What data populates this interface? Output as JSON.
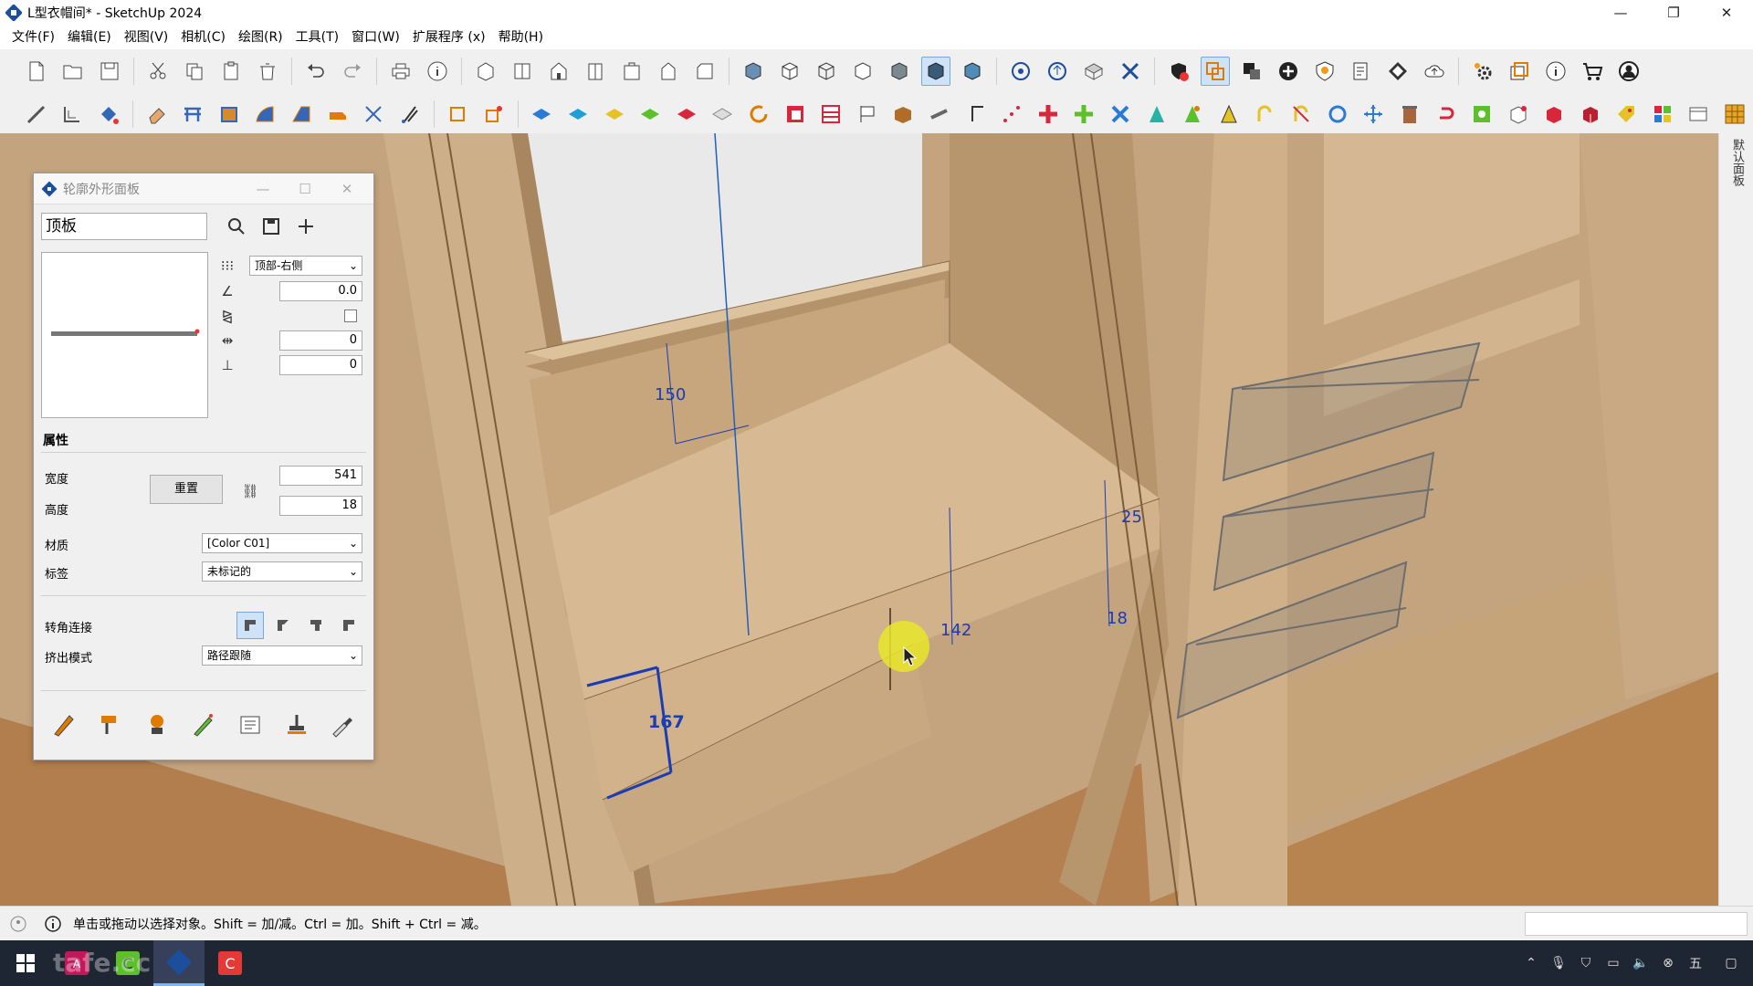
{
  "window": {
    "title": "L型衣帽间* - SketchUp 2024",
    "minimize": "—",
    "maximize": "❐",
    "close": "✕"
  },
  "menu": [
    "文件(F)",
    "编辑(E)",
    "视图(V)",
    "相机(C)",
    "绘图(R)",
    "工具(T)",
    "窗口(W)",
    "扩展程序 (x)",
    "帮助(H)"
  ],
  "side_tab": {
    "label": "默认面板"
  },
  "panel": {
    "title": "轮廓外形面板",
    "name_value": "顶板",
    "alignment_select": "顶部-右侧",
    "angle_value": "0.0",
    "offset_x_value": "0",
    "offset_y_value": "0",
    "properties_title": "属性",
    "width_label": "宽度",
    "width_value": "541",
    "height_label": "高度",
    "height_value": "18",
    "reset_label": "重置",
    "material_label": "材质",
    "material_value": "[Color C01]",
    "tag_label": "标签",
    "tag_value": "未标记的",
    "corner_label": "转角连接",
    "extrude_label": "挤出模式",
    "extrude_value": "路径跟随"
  },
  "dimensions": [
    "150",
    "25",
    "142",
    "18",
    "167"
  ],
  "status": {
    "text": "单击或拖动以选择对象。Shift = 加/减。Ctrl = 加。Shift + Ctrl = 减。"
  },
  "taskbar": {
    "watermark": "tafe.cc",
    "input_method": "五"
  },
  "colors": {
    "accent": "#1e5fbf",
    "wood": "#c9ab86",
    "floor": "#b5875a",
    "dimension": "#1a3cb5"
  }
}
